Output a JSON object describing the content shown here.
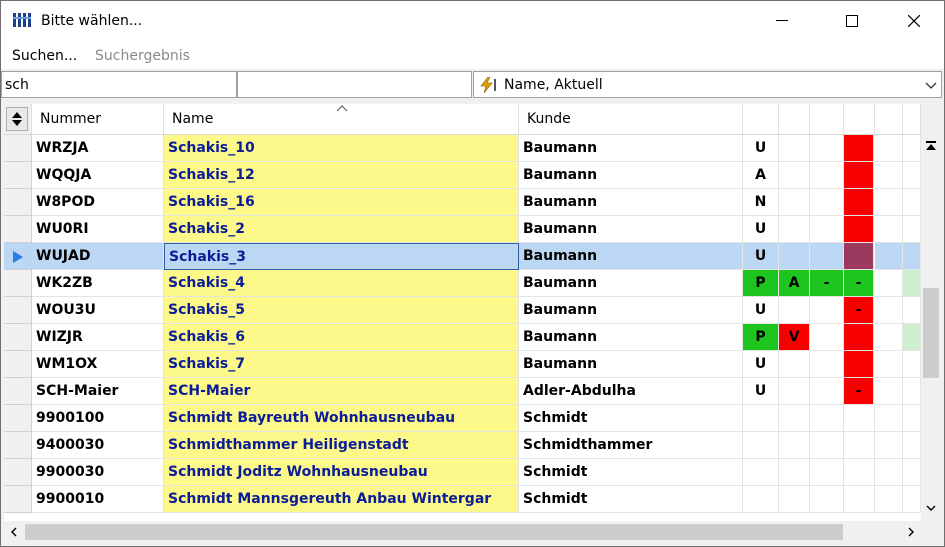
{
  "window": {
    "title": "Bitte wählen...",
    "minimize_label": "Minimize",
    "maximize_label": "Maximize",
    "close_label": "Close"
  },
  "menu": {
    "items": [
      {
        "label": "Suchen...",
        "enabled": true
      },
      {
        "label": "Suchergebnis",
        "enabled": false
      }
    ]
  },
  "search": {
    "value": "sch",
    "second_value": "",
    "sort_combo": "Name, Aktuell"
  },
  "table": {
    "columns": [
      "Nummer",
      "Name",
      "Kunde"
    ],
    "sort_column": "Name",
    "rows": [
      {
        "nummer": "WRZJA",
        "name": "Schakis_10",
        "kunde": "Baumann",
        "s1": "U",
        "s2": "",
        "s3": "",
        "s4": "",
        "s4color": "red",
        "selected": false
      },
      {
        "nummer": "WQQJA",
        "name": "Schakis_12",
        "kunde": "Baumann",
        "s1": "A",
        "s2": "",
        "s3": "",
        "s4": "",
        "s4color": "red",
        "selected": false
      },
      {
        "nummer": "W8POD",
        "name": "Schakis_16",
        "kunde": "Baumann",
        "s1": "N",
        "s2": "",
        "s3": "",
        "s4": "",
        "s4color": "red",
        "selected": false
      },
      {
        "nummer": "WU0RI",
        "name": "Schakis_2",
        "kunde": "Baumann",
        "s1": "U",
        "s2": "",
        "s3": "",
        "s4": "",
        "s4color": "red",
        "selected": false
      },
      {
        "nummer": "WUJAD",
        "name": "Schakis_3",
        "kunde": "Baumann",
        "s1": "U",
        "s2": "",
        "s3": "",
        "s4": "",
        "s4color": "darkred",
        "selected": true
      },
      {
        "nummer": "WK2ZB",
        "name": "Schakis_4",
        "kunde": "Baumann",
        "s1": "P",
        "s2": "A",
        "s3": "-",
        "s4": "-",
        "s4color": "green",
        "allgreen": true,
        "selected": false
      },
      {
        "nummer": "WOU3U",
        "name": "Schakis_5",
        "kunde": "Baumann",
        "s1": "U",
        "s2": "",
        "s3": "",
        "s4": "-",
        "s4color": "red",
        "selected": false
      },
      {
        "nummer": "WIZJR",
        "name": "Schakis_6",
        "kunde": "Baumann",
        "s1": "P",
        "s2": "V",
        "s3": "",
        "s4": "",
        "s4color": "red",
        "s1green": true,
        "s2red": true,
        "selected": false
      },
      {
        "nummer": "WM1OX",
        "name": "Schakis_7",
        "kunde": "Baumann",
        "s1": "U",
        "s2": "",
        "s3": "",
        "s4": "",
        "s4color": "red",
        "selected": false
      },
      {
        "nummer": "SCH-Maier",
        "name": "SCH-Maier",
        "kunde": "Adler-Abdulha",
        "s1": "U",
        "s2": "",
        "s3": "",
        "s4": "-",
        "s4color": "red",
        "selected": false
      },
      {
        "nummer": "9900100",
        "name": "Schmidt Bayreuth Wohnhausneubau",
        "kunde": "Schmidt",
        "s1": "",
        "s2": "",
        "s3": "",
        "s4": "",
        "s4color": "",
        "selected": false
      },
      {
        "nummer": "9400030",
        "name": "Schmidthammer Heiligenstadt",
        "kunde": "Schmidthammer",
        "s1": "",
        "s2": "",
        "s3": "",
        "s4": "",
        "s4color": "",
        "selected": false
      },
      {
        "nummer": "9900030",
        "name": "Schmidt Joditz Wohnhausneubau",
        "kunde": "Schmidt",
        "s1": "",
        "s2": "",
        "s3": "",
        "s4": "",
        "s4color": "",
        "selected": false
      },
      {
        "nummer": "9900010",
        "name": "Schmidt Mannsgereuth Anbau Wintergar",
        "kunde": "Schmidt",
        "s1": "",
        "s2": "",
        "s3": "",
        "s4": "",
        "s4color": "",
        "selected": false
      }
    ]
  },
  "colors": {
    "name_bg": "#fcf88a",
    "name_text": "#0b1d96",
    "selection": "#bcd7f3",
    "status_red": "#f80000",
    "status_green": "#1ec51e",
    "status_darkred": "#9b3a5e"
  },
  "icons": [
    "app-icon",
    "minimize-icon",
    "maximize-icon",
    "close-icon",
    "lightning-icon",
    "chevron-down-icon",
    "sort-updown-icon",
    "current-row-arrow-icon",
    "scroll-top-icon",
    "scroll-down-icon",
    "scroll-left-icon",
    "scroll-right-icon"
  ]
}
